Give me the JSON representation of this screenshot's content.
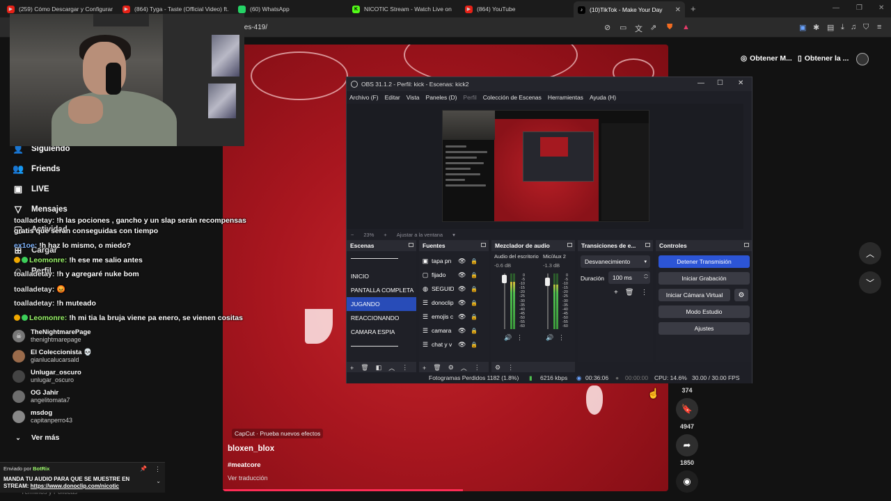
{
  "tabs": [
    {
      "label": "(259) Cómo Descargar y Configurar",
      "icon": "youtube-icon"
    },
    {
      "label": "(864) Tyga - Taste (Official Video) ft.",
      "icon": "youtube-icon"
    },
    {
      "label": "(60) WhatsApp",
      "icon": "whatsapp-icon"
    },
    {
      "label": "NICOTIC Stream - Watch Live on",
      "icon": "kick-icon"
    },
    {
      "label": "(864) YouTube",
      "icon": "youtube-icon"
    },
    {
      "label": "(10)TikTok - Make Your Day",
      "icon": "tiktok-icon",
      "active": true
    }
  ],
  "address": {
    "url": "/es-419/"
  },
  "tiktok": {
    "get_app_1": "Obtener M...",
    "get_app_2": "Obtener la ...",
    "sidebar": {
      "following": "Siguiendo",
      "friends": "Friends",
      "live": "LIVE",
      "messages": "Mensajes",
      "activity": "Actividad",
      "upload": "Cargar",
      "profile": "Perfil"
    },
    "following_accounts": [
      {
        "name": "TheNightmarePage",
        "user": "thenightmarepage"
      },
      {
        "name": "El Coleccionista 💀",
        "user": "gianlucalucarsald"
      },
      {
        "name": "Unlugar_oscuro",
        "user": "unlugar_oscuro"
      },
      {
        "name": "OG Jahir",
        "user": "angelitomata7"
      },
      {
        "name": "msdog",
        "user": "capitanperro43"
      }
    ],
    "see_more": "Ver más",
    "footer_text": "Términos y Políticas",
    "video": {
      "capcut": "CapCut · Prueba nuevos efectos",
      "author": "bloxen_blox",
      "tag": "#meatcore",
      "translate": "Ver traducción"
    },
    "actions": {
      "bookmark_count_above": "374",
      "bookmark_count": "4947",
      "share_count": "1850"
    }
  },
  "chat": [
    {
      "user": "toalladetay:",
      "text": "!h las pociones , gancho y un slap serán recompensas"
    },
    {
      "user": "",
      "text": "gratis que serán conseguidas con tiempo"
    },
    {
      "user": "ex1oe:",
      "text": "!h haz lo mismo, o miedo?"
    },
    {
      "user": "Leomonre:",
      "text": "!h ese me salio antes"
    },
    {
      "user": "toalladetay:",
      "text": "!h y agregaré nuke bom"
    },
    {
      "user": "toalladetay:",
      "text": "😡"
    },
    {
      "user": "toalladetay:",
      "text": "!h muteado"
    },
    {
      "user": "Leomonre:",
      "text": "!h mi tia la bruja viene pa enero, se vienen cositas"
    }
  ],
  "botrix": {
    "sent_by": "Enviado por",
    "bot": "BotRix",
    "message": "MANDA TU AUDIO PARA QUE SE MUESTRE EN STREAM: ",
    "link": "https://www.donoclip.com/nicotic"
  },
  "obs": {
    "title": "OBS 31.1.2 - Perfil: kick - Escenas: kick2",
    "menu": [
      "Archivo (F)",
      "Editar",
      "Vista",
      "Paneles (D)",
      "Perfil",
      "Colección de Escenas",
      "Herramientas",
      "Ayuda (H)"
    ],
    "zoom": "23%",
    "fit": "Ajustar a la ventana",
    "docks": {
      "scenes": "Escenas",
      "sources": "Fuentes",
      "mixer": "Mezclador de audio",
      "transitions": "Transiciones de e...",
      "controls": "Controles"
    },
    "scenes": [
      "INICIO",
      "PANTALLA COMPLETA",
      "JUGANDO",
      "REACCIONANDO",
      "CAMARA ESPIA"
    ],
    "selected_scene": "JUGANDO",
    "sources": [
      {
        "name": "tapa pn",
        "icon": "image-icon"
      },
      {
        "name": "fijado",
        "icon": "window-icon"
      },
      {
        "name": "SEGUID",
        "icon": "browser-icon"
      },
      {
        "name": "donoclip",
        "icon": "list-icon"
      },
      {
        "name": "emojis c",
        "icon": "list-icon"
      },
      {
        "name": "camara",
        "icon": "list-icon"
      },
      {
        "name": "chat y v",
        "icon": "list-icon"
      }
    ],
    "mixer": [
      {
        "name": "Audio del escritorio",
        "db": "-0.6 dB",
        "level": 0.85
      },
      {
        "name": "Mic/Aux 2",
        "db": "-1.3 dB",
        "level": 0.8
      }
    ],
    "db_scale": [
      "0",
      "-5",
      "-10",
      "-15",
      "-20",
      "-25",
      "-30",
      "-35",
      "-40",
      "-45",
      "-50",
      "-55",
      "-60"
    ],
    "transition": {
      "type": "Desvanecimiento",
      "duration_label": "Duración",
      "duration": "100 ms"
    },
    "controls": {
      "stop_stream": "Detener Transmisión",
      "start_record": "Iniciar Grabación",
      "virtual_cam": "Iniciar Cámara Virtual",
      "studio": "Modo Estudio",
      "settings": "Ajustes"
    },
    "status": {
      "dropped": "Fotogramas Perdidos 1182 (1.8%)",
      "bitrate": "6216 kbps",
      "stream_time": "00:36:06",
      "rec_time": "00:00:00",
      "cpu": "CPU: 14.6%",
      "fps": "30.00 / 30.00 FPS"
    }
  }
}
